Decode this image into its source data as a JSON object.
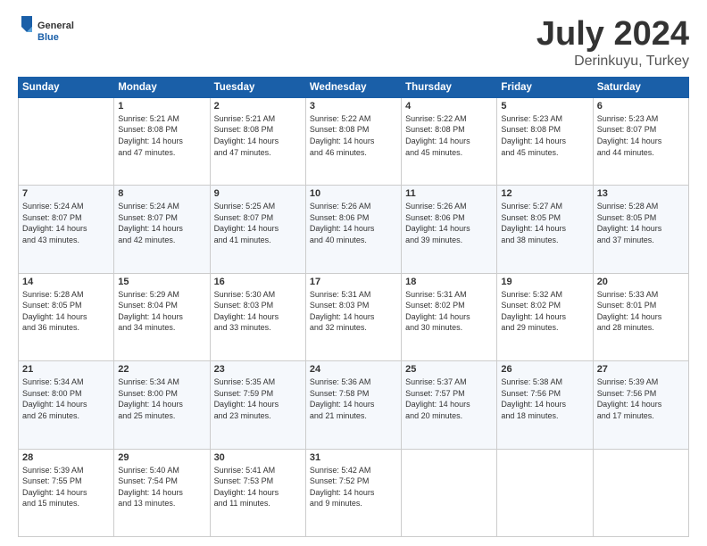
{
  "header": {
    "logo": {
      "general": "General",
      "blue": "Blue"
    },
    "title": "July 2024",
    "location": "Derinkuyu, Turkey"
  },
  "weekdays": [
    "Sunday",
    "Monday",
    "Tuesday",
    "Wednesday",
    "Thursday",
    "Friday",
    "Saturday"
  ],
  "weeks": [
    [
      {
        "day": "",
        "info": ""
      },
      {
        "day": "1",
        "info": "Sunrise: 5:21 AM\nSunset: 8:08 PM\nDaylight: 14 hours\nand 47 minutes."
      },
      {
        "day": "2",
        "info": "Sunrise: 5:21 AM\nSunset: 8:08 PM\nDaylight: 14 hours\nand 47 minutes."
      },
      {
        "day": "3",
        "info": "Sunrise: 5:22 AM\nSunset: 8:08 PM\nDaylight: 14 hours\nand 46 minutes."
      },
      {
        "day": "4",
        "info": "Sunrise: 5:22 AM\nSunset: 8:08 PM\nDaylight: 14 hours\nand 45 minutes."
      },
      {
        "day": "5",
        "info": "Sunrise: 5:23 AM\nSunset: 8:08 PM\nDaylight: 14 hours\nand 45 minutes."
      },
      {
        "day": "6",
        "info": "Sunrise: 5:23 AM\nSunset: 8:07 PM\nDaylight: 14 hours\nand 44 minutes."
      }
    ],
    [
      {
        "day": "7",
        "info": "Sunrise: 5:24 AM\nSunset: 8:07 PM\nDaylight: 14 hours\nand 43 minutes."
      },
      {
        "day": "8",
        "info": "Sunrise: 5:24 AM\nSunset: 8:07 PM\nDaylight: 14 hours\nand 42 minutes."
      },
      {
        "day": "9",
        "info": "Sunrise: 5:25 AM\nSunset: 8:07 PM\nDaylight: 14 hours\nand 41 minutes."
      },
      {
        "day": "10",
        "info": "Sunrise: 5:26 AM\nSunset: 8:06 PM\nDaylight: 14 hours\nand 40 minutes."
      },
      {
        "day": "11",
        "info": "Sunrise: 5:26 AM\nSunset: 8:06 PM\nDaylight: 14 hours\nand 39 minutes."
      },
      {
        "day": "12",
        "info": "Sunrise: 5:27 AM\nSunset: 8:05 PM\nDaylight: 14 hours\nand 38 minutes."
      },
      {
        "day": "13",
        "info": "Sunrise: 5:28 AM\nSunset: 8:05 PM\nDaylight: 14 hours\nand 37 minutes."
      }
    ],
    [
      {
        "day": "14",
        "info": "Sunrise: 5:28 AM\nSunset: 8:05 PM\nDaylight: 14 hours\nand 36 minutes."
      },
      {
        "day": "15",
        "info": "Sunrise: 5:29 AM\nSunset: 8:04 PM\nDaylight: 14 hours\nand 34 minutes."
      },
      {
        "day": "16",
        "info": "Sunrise: 5:30 AM\nSunset: 8:03 PM\nDaylight: 14 hours\nand 33 minutes."
      },
      {
        "day": "17",
        "info": "Sunrise: 5:31 AM\nSunset: 8:03 PM\nDaylight: 14 hours\nand 32 minutes."
      },
      {
        "day": "18",
        "info": "Sunrise: 5:31 AM\nSunset: 8:02 PM\nDaylight: 14 hours\nand 30 minutes."
      },
      {
        "day": "19",
        "info": "Sunrise: 5:32 AM\nSunset: 8:02 PM\nDaylight: 14 hours\nand 29 minutes."
      },
      {
        "day": "20",
        "info": "Sunrise: 5:33 AM\nSunset: 8:01 PM\nDaylight: 14 hours\nand 28 minutes."
      }
    ],
    [
      {
        "day": "21",
        "info": "Sunrise: 5:34 AM\nSunset: 8:00 PM\nDaylight: 14 hours\nand 26 minutes."
      },
      {
        "day": "22",
        "info": "Sunrise: 5:34 AM\nSunset: 8:00 PM\nDaylight: 14 hours\nand 25 minutes."
      },
      {
        "day": "23",
        "info": "Sunrise: 5:35 AM\nSunset: 7:59 PM\nDaylight: 14 hours\nand 23 minutes."
      },
      {
        "day": "24",
        "info": "Sunrise: 5:36 AM\nSunset: 7:58 PM\nDaylight: 14 hours\nand 21 minutes."
      },
      {
        "day": "25",
        "info": "Sunrise: 5:37 AM\nSunset: 7:57 PM\nDaylight: 14 hours\nand 20 minutes."
      },
      {
        "day": "26",
        "info": "Sunrise: 5:38 AM\nSunset: 7:56 PM\nDaylight: 14 hours\nand 18 minutes."
      },
      {
        "day": "27",
        "info": "Sunrise: 5:39 AM\nSunset: 7:56 PM\nDaylight: 14 hours\nand 17 minutes."
      }
    ],
    [
      {
        "day": "28",
        "info": "Sunrise: 5:39 AM\nSunset: 7:55 PM\nDaylight: 14 hours\nand 15 minutes."
      },
      {
        "day": "29",
        "info": "Sunrise: 5:40 AM\nSunset: 7:54 PM\nDaylight: 14 hours\nand 13 minutes."
      },
      {
        "day": "30",
        "info": "Sunrise: 5:41 AM\nSunset: 7:53 PM\nDaylight: 14 hours\nand 11 minutes."
      },
      {
        "day": "31",
        "info": "Sunrise: 5:42 AM\nSunset: 7:52 PM\nDaylight: 14 hours\nand 9 minutes."
      },
      {
        "day": "",
        "info": ""
      },
      {
        "day": "",
        "info": ""
      },
      {
        "day": "",
        "info": ""
      }
    ]
  ]
}
